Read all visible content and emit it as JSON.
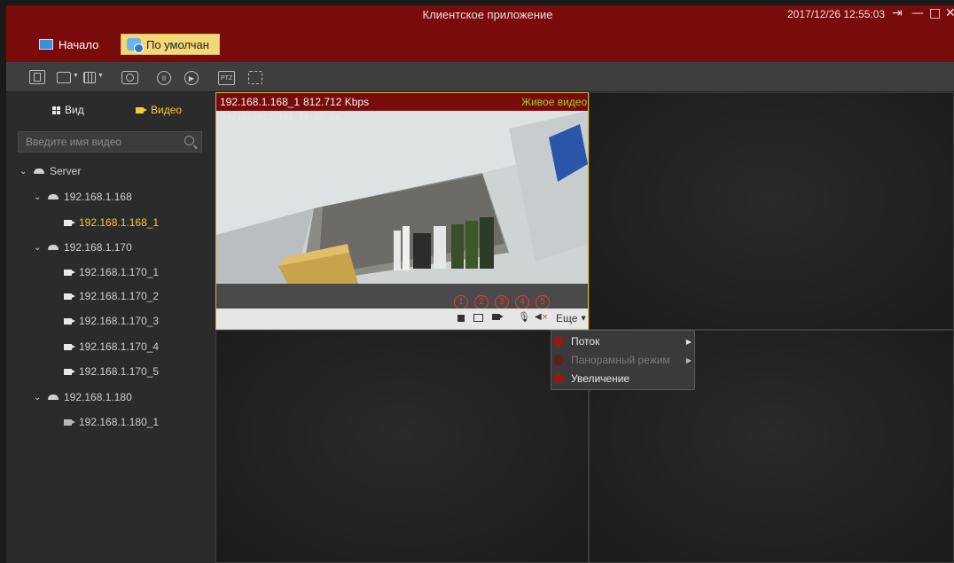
{
  "window": {
    "title": "Клиентское приложение",
    "datetime": "2017/12/26 12:55:03",
    "buttons": [
      "logout-icon",
      "minimize-icon",
      "maximize-icon",
      "close-icon"
    ]
  },
  "tabs": {
    "home": "Начало",
    "default": "По умолчан"
  },
  "toolbar": {
    "ptz": "PTZ"
  },
  "sidebar": {
    "tab_view": "Вид",
    "tab_video": "Видео",
    "search_placeholder": "Введите имя видео",
    "tree": {
      "server": "Server",
      "groups": [
        {
          "name": "192.168.1.168",
          "cameras": [
            "192.168.1.168_1"
          ]
        },
        {
          "name": "192.168.1.170",
          "cameras": [
            "192.168.1.170_1",
            "192.168.1.170_2",
            "192.168.1.170_3",
            "192.168.1.170_4",
            "192.168.1.170_5"
          ]
        },
        {
          "name": "192.168.1.180",
          "cameras": [
            "192.168.1.180_1"
          ]
        }
      ],
      "selected": "192.168.1.168_1"
    }
  },
  "video": {
    "name": "192.168.1.168_1",
    "bitrate": "812.712 Kbps",
    "status": "Живое видео",
    "timestamp": "26/12/2017 TUE 10:07:34",
    "more_label": "Еще",
    "markers": [
      "1",
      "2",
      "3",
      "4",
      "5"
    ]
  },
  "context_menu": {
    "items": [
      {
        "label": "Поток",
        "enabled": true,
        "submenu": true
      },
      {
        "label": "Панорамный режим",
        "enabled": false,
        "submenu": true
      },
      {
        "label": "Увеличение",
        "enabled": true,
        "submenu": false
      }
    ]
  },
  "colors": {
    "brand": "#7a0b0b",
    "accent": "#f3cc36",
    "live": "#9ed12c",
    "marker": "#e43c2f"
  }
}
